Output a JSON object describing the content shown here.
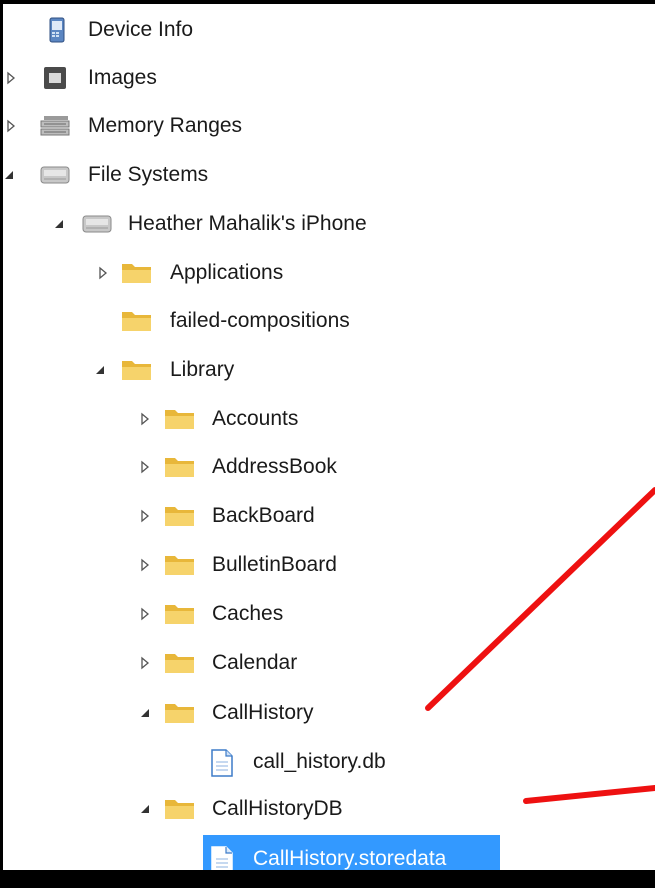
{
  "tree": {
    "device_info": {
      "label": "Device Info",
      "icon": "phone-icon"
    },
    "images": {
      "label": "Images",
      "icon": "image-icon"
    },
    "memory_ranges": {
      "label": "Memory Ranges",
      "icon": "memory-icon"
    },
    "file_systems": {
      "label": "File Systems",
      "icon": "drive-icon"
    },
    "device": {
      "label": "Heather Mahalik's iPhone",
      "icon": "drive-icon"
    },
    "applications": {
      "label": "Applications",
      "icon": "folder-icon"
    },
    "failed_compositions": {
      "label": "failed-compositions",
      "icon": "folder-icon"
    },
    "library": {
      "label": "Library",
      "icon": "folder-icon"
    },
    "accounts": {
      "label": "Accounts",
      "icon": "folder-icon"
    },
    "addressbook": {
      "label": "AddressBook",
      "icon": "folder-icon"
    },
    "backboard": {
      "label": "BackBoard",
      "icon": "folder-icon"
    },
    "bulletinboard": {
      "label": "BulletinBoard",
      "icon": "folder-icon"
    },
    "caches": {
      "label": "Caches",
      "icon": "folder-icon"
    },
    "calendar": {
      "label": "Calendar",
      "icon": "folder-icon"
    },
    "callhistory": {
      "label": "CallHistory",
      "icon": "folder-icon"
    },
    "call_history_db": {
      "label": "call_history.db",
      "icon": "file-icon"
    },
    "callhistorydb": {
      "label": "CallHistoryDB",
      "icon": "folder-icon"
    },
    "callhistory_storedata": {
      "label": "CallHistory.storedata",
      "icon": "file-icon",
      "selected": true
    }
  },
  "colors": {
    "selection": "#3399ff",
    "arrow": "#ee1111",
    "folder": "#f4c94e"
  }
}
